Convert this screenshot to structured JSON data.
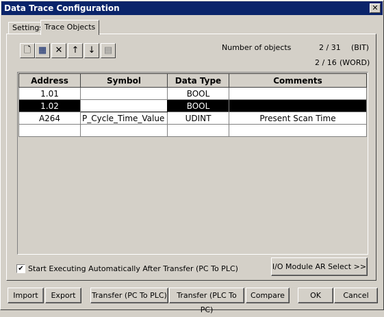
{
  "window": {
    "title": "Data Trace Configuration",
    "close_glyph": "✕"
  },
  "tabs": [
    {
      "label": "Settings",
      "active": false
    },
    {
      "label": "Trace Objects",
      "active": true
    }
  ],
  "toolbar": {
    "icons": [
      "new-icon",
      "edit-icon",
      "delete-icon",
      "move-up-icon",
      "move-down-icon",
      "paste-icon"
    ],
    "glyphs": [
      "🗋",
      "▦",
      "✕",
      "↑",
      "↓",
      "▤"
    ]
  },
  "info": {
    "number_of_objects_label": "Number of objects",
    "bit_count": "2 / 31",
    "bit_unit": "(BIT)",
    "word_count": "2 / 16",
    "word_unit": "(WORD)"
  },
  "table": {
    "columns": [
      "Address",
      "Symbol",
      "Data Type",
      "Comments"
    ],
    "rows": [
      {
        "address": "1.01",
        "symbol": "",
        "data_type": "BOOL",
        "comments": ""
      },
      {
        "address": "1.02",
        "symbol": "",
        "data_type": "BOOL",
        "comments": "",
        "selected": true
      },
      {
        "address": "A264",
        "symbol": "P_Cycle_Time_Value",
        "data_type": "UDINT",
        "comments": "Present Scan Time"
      },
      {
        "address": "",
        "symbol": "",
        "data_type": "",
        "comments": ""
      }
    ]
  },
  "auto_execute": {
    "checked": true,
    "check_glyph": "✔",
    "label": "Start Executing Automatically After Transfer (PC To PLC)"
  },
  "io_module_button": "I/O Module AR Select >>",
  "buttons": {
    "import": "Import",
    "export": "Export",
    "transfer_pc_to_plc": "Transfer (PC To PLC)",
    "transfer_plc_to_pc": "Transfer (PLC To PC)",
    "compare": "Compare",
    "ok": "OK",
    "cancel": "Cancel"
  },
  "colors": {
    "titlebar": "#0a246a",
    "face": "#d4d0c8",
    "selection": "#000000"
  }
}
